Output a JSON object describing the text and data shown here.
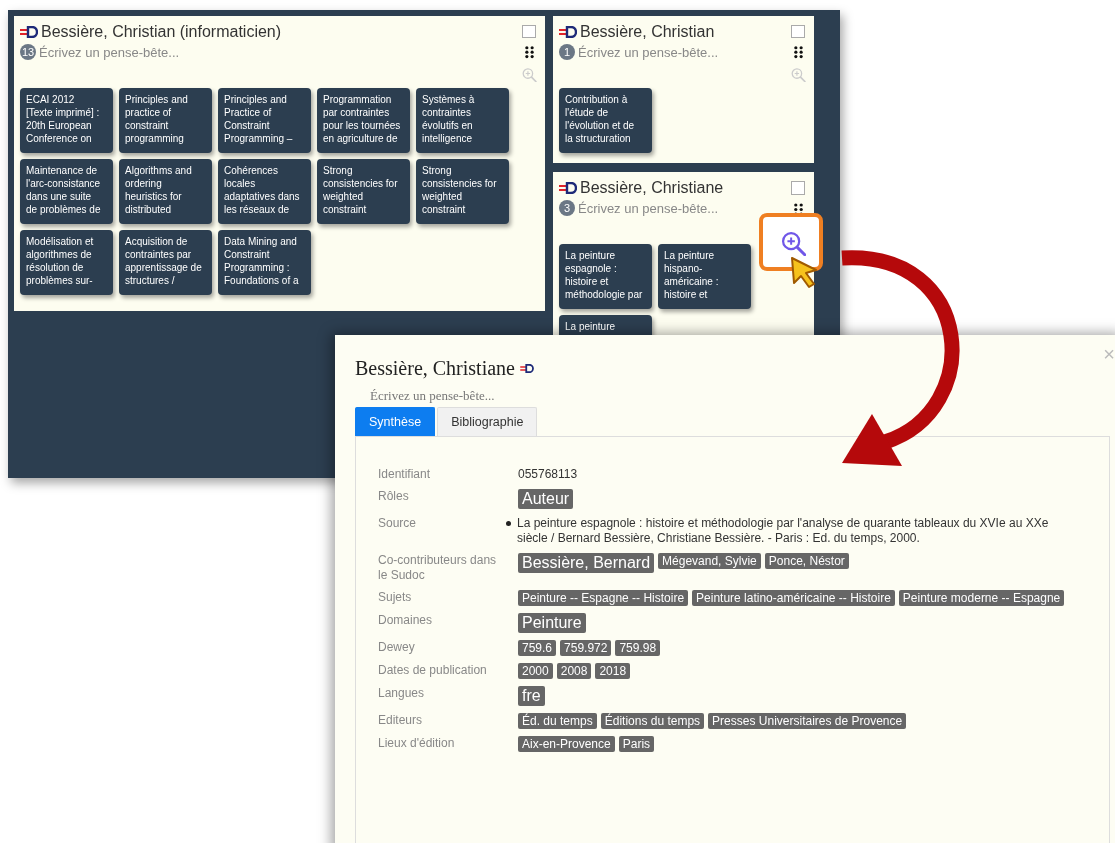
{
  "cards": [
    {
      "name": "Bessière, Christian (informaticien)",
      "count": "13",
      "placeholder": "Écrivez un pense-bête...",
      "checked": false,
      "highlighted": false,
      "wide": true,
      "tiles": [
        {
          "lines": [
            "ECAI 2012",
            "[Texte imprimé] :",
            "20th European",
            "Conference on"
          ]
        },
        {
          "lines": [
            "Principles and",
            "practice of",
            "constraint",
            "programming"
          ]
        },
        {
          "lines": [
            "Principles and",
            "Practice of",
            "Constraint",
            "Programming –"
          ]
        },
        {
          "lines": [
            "Programmation",
            "par contraintes",
            "pour les tournées",
            "en agriculture de"
          ]
        },
        {
          "lines": [
            "Systèmes à",
            "contraintes",
            "évolutifs en",
            "intelligence"
          ]
        },
        {
          "lines": [
            "Maintenance de",
            "l'arc-consistance",
            "dans une suite",
            "de problèmes de"
          ]
        },
        {
          "lines": [
            "Algorithms and",
            "ordering",
            "heuristics for",
            "distributed"
          ]
        },
        {
          "lines": [
            "Cohérences",
            "locales",
            "adaptatives dans",
            "les réseaux de"
          ]
        },
        {
          "lines": [
            "Strong",
            "consistencies for",
            "weighted",
            "constraint"
          ]
        },
        {
          "lines": [
            "Strong",
            "consistencies for",
            "weighted",
            "constraint"
          ]
        },
        {
          "lines": [
            "Modélisation et",
            "algorithmes de",
            "résolution de",
            "problèmes sur-"
          ]
        },
        {
          "lines": [
            "Acquisition de",
            "contraintes par",
            "apprentissage de",
            "structures /"
          ]
        },
        {
          "lines": [
            "Data Mining and",
            "Constraint",
            "Programming :",
            "Foundations of a"
          ]
        }
      ]
    },
    {
      "name": "Bessière, Christian",
      "count": "1",
      "placeholder": "Écrivez un pense-bête...",
      "checked": false,
      "highlighted": false,
      "wide": false,
      "tiles": [
        {
          "lines": [
            "Contribution à",
            "l'étude de",
            "l'évolution et de",
            "la structuration"
          ]
        }
      ]
    },
    {
      "name": "Bessière, Christiane",
      "count": "3",
      "placeholder": "Écrivez un pense-bête...",
      "checked": false,
      "highlighted": true,
      "wide": false,
      "tiles": [
        {
          "lines": [
            "La peinture",
            "espagnole :",
            "histoire et",
            "méthodologie par"
          ]
        },
        {
          "lines": [
            "La peinture",
            "hispano-",
            "américaine :",
            "histoire et"
          ]
        },
        {
          "lines": [
            "La peinture"
          ]
        }
      ]
    }
  ],
  "modal": {
    "title": "Bessière, Christiane",
    "close": "×",
    "placeholder": "Écrivez un pense-bête...",
    "tabs": [
      {
        "label": "Synthèse",
        "selected": true
      },
      {
        "label": "Bibliographie",
        "selected": false
      }
    ],
    "rows": [
      {
        "label": "Identifiant",
        "kind": "text",
        "text": "055768113"
      },
      {
        "label": "Rôles",
        "kind": "tags",
        "tags": [
          {
            "text": "Auteur",
            "prominent": true
          }
        ]
      },
      {
        "label": "Source",
        "kind": "list",
        "items": [
          "La peinture espagnole : histoire et méthodologie par l'analyse de quarante tableaux du XVIe au XXe siècle / Bernard Bessière, Christiane Bessière. - Paris : Ed. du temps, 2000."
        ]
      },
      {
        "label": "Co-contributeurs dans le Sudoc",
        "kind": "tags",
        "tags": [
          {
            "text": "Bessière, Bernard",
            "prominent": true
          },
          {
            "text": "Mégevand, Sylvie",
            "prominent": false
          },
          {
            "text": "Ponce, Néstor",
            "prominent": false
          }
        ]
      },
      {
        "label": "Sujets",
        "kind": "tags",
        "tags": [
          {
            "text": "Peinture -- Espagne -- Histoire",
            "prominent": false
          },
          {
            "text": "Peinture latino-américaine -- Histoire",
            "prominent": false
          },
          {
            "text": "Peinture moderne -- Espagne",
            "prominent": false
          }
        ]
      },
      {
        "label": "Domaines",
        "kind": "tags",
        "tags": [
          {
            "text": "Peinture",
            "prominent": true
          }
        ]
      },
      {
        "label": "Dewey",
        "kind": "tags",
        "tags": [
          {
            "text": "759.6",
            "prominent": false
          },
          {
            "text": "759.972",
            "prominent": false
          },
          {
            "text": "759.98",
            "prominent": false
          }
        ]
      },
      {
        "label": "Dates de publication",
        "kind": "tags",
        "tags": [
          {
            "text": "2000",
            "prominent": false
          },
          {
            "text": "2008",
            "prominent": false
          },
          {
            "text": "2018",
            "prominent": false
          }
        ]
      },
      {
        "label": "Langues",
        "kind": "tags",
        "tags": [
          {
            "text": "fre",
            "prominent": true
          }
        ]
      },
      {
        "label": "Editeurs",
        "kind": "tags",
        "tags": [
          {
            "text": "Éd. du temps",
            "prominent": false
          },
          {
            "text": "Éditions du temps",
            "prominent": false
          },
          {
            "text": "Presses Universitaires de Provence",
            "prominent": false
          }
        ]
      },
      {
        "label": "Lieux d'édition",
        "kind": "tags",
        "tags": [
          {
            "text": "Aix-en-Provence",
            "prominent": false
          },
          {
            "text": "Paris",
            "prominent": false
          }
        ]
      }
    ]
  }
}
